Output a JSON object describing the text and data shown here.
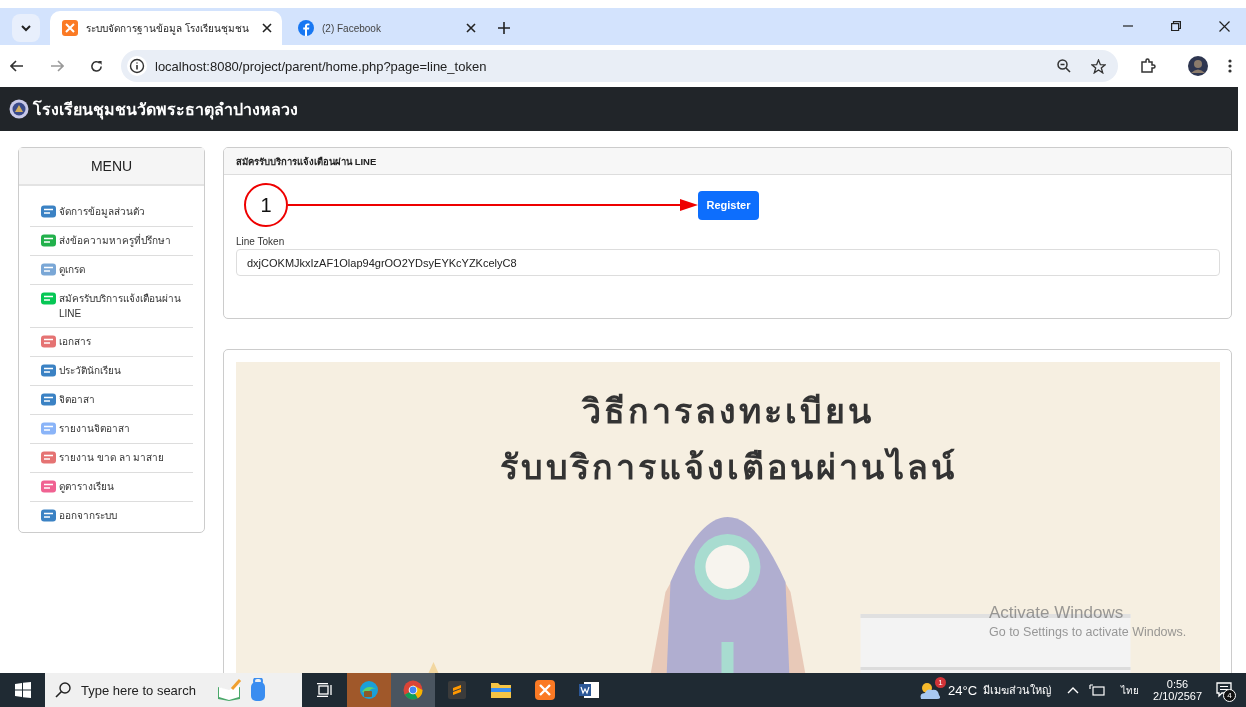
{
  "browser": {
    "tabs": [
      {
        "title": "ระบบจัดการฐานข้อมูล โรงเรียนชุมชน",
        "selected": true
      },
      {
        "title": "(2) Facebook",
        "selected": false
      }
    ],
    "address": "localhost:8080/project/parent/home.php?page=line_token"
  },
  "navbar": {
    "brand": "โรงเรียนชุมชนวัดพระธาตุลำปางหลวง"
  },
  "sidebar": {
    "title": "MENU",
    "items": [
      {
        "label": "จัดการข้อมูลส่วนตัว"
      },
      {
        "label": "ส่งข้อความหาครูที่ปรึกษา"
      },
      {
        "label": "ดูเกรด"
      },
      {
        "label": "สมัครรับบริการแจ้งเตือนผ่าน LINE"
      },
      {
        "label": "เอกสาร"
      },
      {
        "label": "ประวัตินักเรียน"
      },
      {
        "label": "จิตอาสา"
      },
      {
        "label": "รายงานจิตอาสา"
      },
      {
        "label": "รายงาน ขาด ลา มาสาย"
      },
      {
        "label": "ดูตารางเรียน"
      },
      {
        "label": "ออกจากระบบ"
      }
    ]
  },
  "line_card": {
    "title": "สมัครรับบริการแจ้งเตือนผ่าน LINE",
    "step_marker": "1",
    "button": "Register",
    "field_label": "Line Token",
    "field_value": "dxjCOKMJkxIzAF1Olap94grOO2YDsyEYKcYZKcelyC8"
  },
  "guide_image": {
    "kind": "picture",
    "heading": [
      "วิธีการลงทะเบียน",
      "รับบริการแจ้งเตือนผ่านไลน์"
    ]
  },
  "os_notice": {
    "title": "Activate Windows",
    "text": "Go to Settings to activate Windows."
  },
  "taskbar": {
    "search_placeholder": "Type here to search",
    "temperature": "24°C",
    "weather": "มีเมฆส่วนใหญ่",
    "weather_badge": "1",
    "language": "ไทย",
    "time": "0:56",
    "date": "2/10/2567",
    "notification_count": "4"
  }
}
